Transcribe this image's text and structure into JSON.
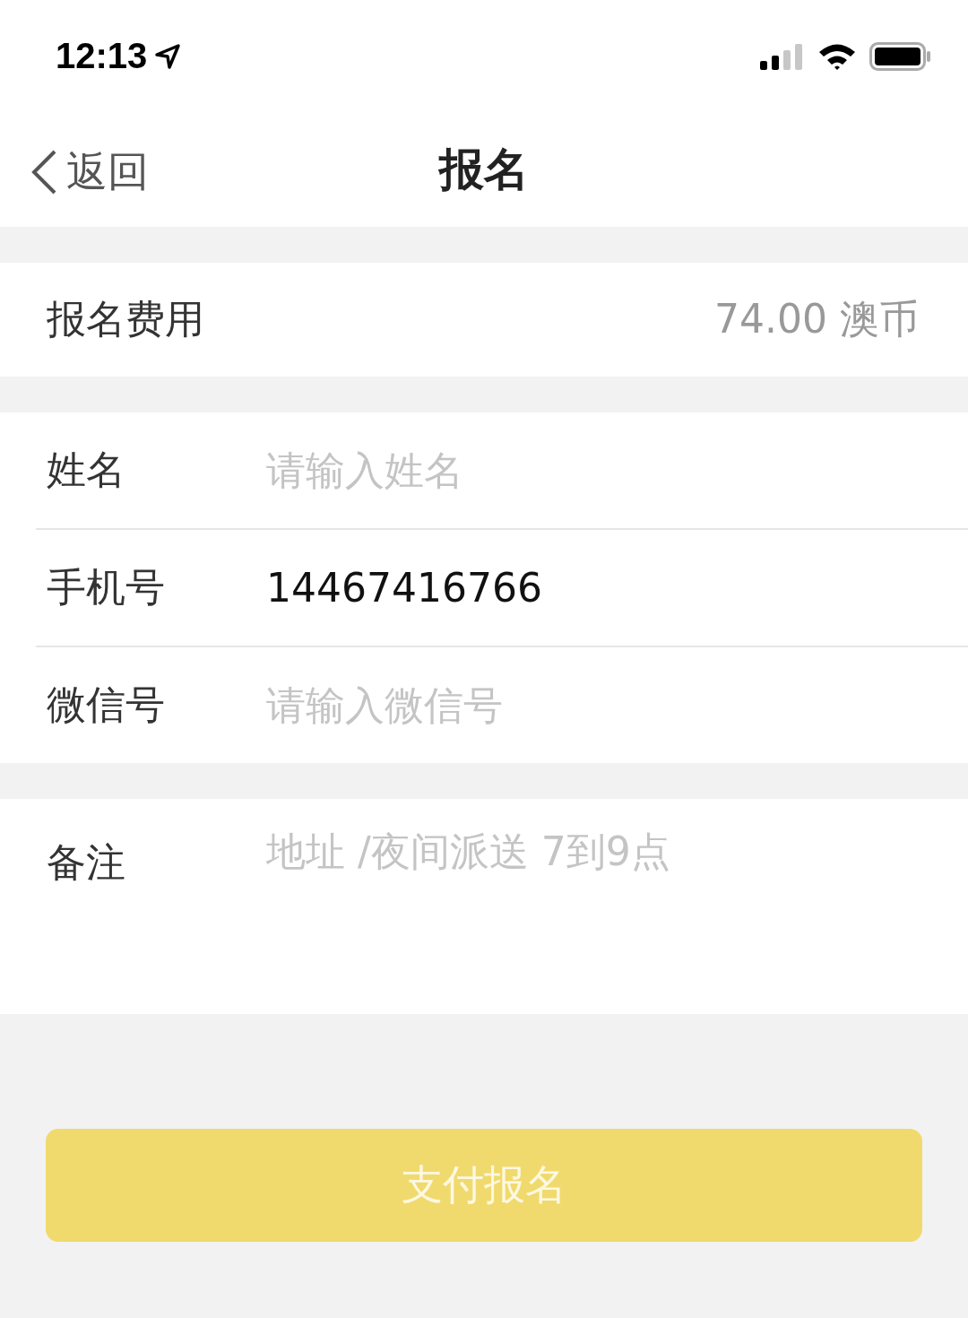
{
  "status_bar": {
    "time": "12:13"
  },
  "nav": {
    "back": "返回",
    "title": "报名"
  },
  "fee": {
    "label": "报名费用",
    "value": "74.00 澳币"
  },
  "fields": [
    {
      "label": "姓名",
      "placeholder": "请输入姓名"
    },
    {
      "label": "手机号",
      "value": "14467416766"
    },
    {
      "label": "微信号",
      "placeholder": "请输入微信号"
    }
  ],
  "remark": {
    "label": "备注",
    "placeholder": "地址 /夜间派送 7到9点"
  },
  "submit_button": {
    "label": "支付报名",
    "disabled": true
  }
}
